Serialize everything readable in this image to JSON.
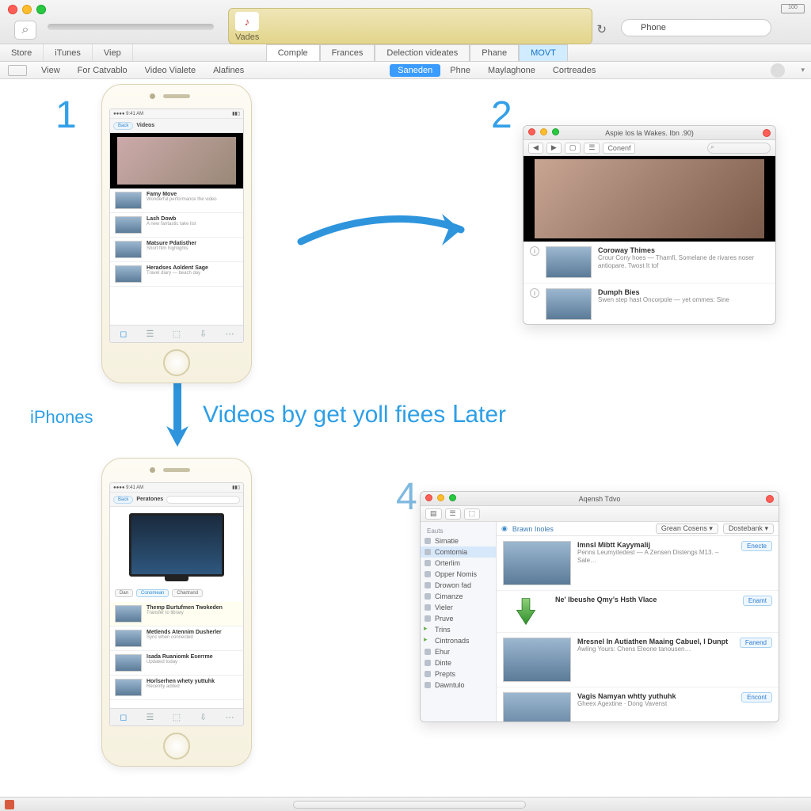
{
  "titlebar": {
    "lcd_badge": "♪",
    "lcd_label": "Vades",
    "apple": "",
    "search_ph": "Phone",
    "battery": "100"
  },
  "menu1": {
    "left": [
      "Store",
      "iTunes",
      "Viep"
    ],
    "mid": [
      "Comple",
      "Frances",
      "Delection videates",
      "Phane",
      "MOVT"
    ]
  },
  "menu2": {
    "mini": "",
    "items": [
      "View",
      "For Catvablo",
      "Video Vialete",
      "Alafines"
    ],
    "chips": [
      "Saneden",
      "Phne",
      "Maylaghone",
      "Cortreades"
    ]
  },
  "steps": {
    "n1": "1",
    "n2": "2",
    "n4": "4",
    "cap1": "iPhones",
    "cap2": "Videos by get yoll fiees Ⅼater"
  },
  "phone1": {
    "status_l": "●●●●  9:41 AM",
    "status_r": "▮▮▯",
    "nav_back": "Back",
    "nav_title": "Videos",
    "list": [
      {
        "t": "Famy Move",
        "s": "Wonderful performance the video"
      },
      {
        "t": "Lash Dowb",
        "s": "A new fantastic take list"
      },
      {
        "t": "Matsure Pdatisther",
        "s": "Short film highlights"
      },
      {
        "t": "Heradses Aoldent Sage",
        "s": "Travel diary — beach day"
      }
    ],
    "tabs": [
      "◻",
      "☰",
      "⬚",
      "⇩",
      "⋯"
    ]
  },
  "win2": {
    "title": "Aspie Ios la Wakes. Ibn .90)",
    "tool_back": "◀",
    "tool_fwd": "▶",
    "tool_v1": "▢",
    "tool_v2": "☰",
    "tool_lbl": "Conenf",
    "list": [
      {
        "t": "Coroway Thimes",
        "s": "Crour Cony hoes — Thamfi, Somelane de rivares noser antiopare. Twost It tof"
      },
      {
        "t": "Dumph Bies",
        "s": "Swen step hast Oncorpole — yet ommes: Sine"
      }
    ]
  },
  "phone3": {
    "status_l": "●●●●  9:41 AM",
    "status_r": "▮▮▯",
    "nav_back": "Back",
    "nav_title": "Peratones",
    "d_label": "Dan",
    "c1": "Conomean",
    "c2": "Chartrand",
    "list": [
      {
        "t": "Themp Burtufmen Twokeden",
        "s": "Transfer to library"
      },
      {
        "t": "Metlends Atennim Dusherler",
        "s": "Sync when connected"
      },
      {
        "t": "Isada Ruaniomk Eserrme",
        "s": "Updated today"
      },
      {
        "t": "Horlserhen whety yuttuhk",
        "s": "Recently added"
      }
    ]
  },
  "win4": {
    "title": "Aqensh Tdvo",
    "path_hd": "Brawn Inoles",
    "path_btn1": "Grean Cosens",
    "path_btn2": "Dostebank",
    "path_caret": "▾",
    "side_hd": "Eauts",
    "side": [
      "Simatie",
      "Comtomia",
      "Orterlim",
      "Opper Nomis",
      "Drowon fad",
      "Cimanze",
      "Vieler",
      "Pruve",
      "Trins",
      "Cintronads",
      "Ehur",
      "Dinte",
      "Prepts",
      "Dawntulo"
    ],
    "rows": [
      {
        "t": "Imnsl Mibtt Kayymalij",
        "s": "Penns Leumyitedest — A Zensen Distengs M13. – Sale…",
        "b": "Enecte"
      },
      {
        "t": "Ne' Ibeushe Qmy’s Hsth Vlace",
        "s": "",
        "b": "Enamt"
      },
      {
        "t": "Mresnel In Autiathen Maaing Cabuel, I Dunpt",
        "s": "Awling Yours: Chens Eleone tanousen…",
        "b": "Fanend"
      },
      {
        "t": "Vagis Namyan whtty yuthuhk",
        "s": "Gheex Agextine · Dong Vavenst",
        "b": "Encont"
      }
    ]
  }
}
